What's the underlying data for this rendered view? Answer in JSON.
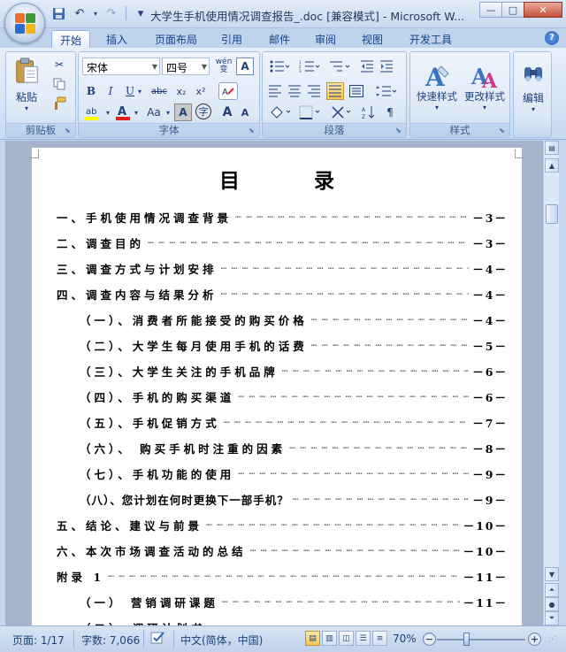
{
  "window": {
    "title": "大学生手机使用情况调查报告_.doc [兼容模式] - Microsoft W...",
    "min_label": "—",
    "max_label": "□",
    "close_label": "✕"
  },
  "quick_access": {
    "save_icon": "floppy-disk-icon",
    "undo_label": "↶",
    "redo_label": "↷",
    "customize_label": "▾"
  },
  "tabs": [
    {
      "label": "开始",
      "active": true
    },
    {
      "label": "插入"
    },
    {
      "label": "页面布局"
    },
    {
      "label": "引用"
    },
    {
      "label": "邮件"
    },
    {
      "label": "审阅"
    },
    {
      "label": "视图"
    },
    {
      "label": "开发工具"
    }
  ],
  "ribbon": {
    "clipboard": {
      "label": "剪贴板",
      "paste_label": "粘贴"
    },
    "font": {
      "label": "字体",
      "font_name": "宋体",
      "font_size": "四号",
      "wen_label": "wén\n变",
      "bold": "B",
      "italic": "I",
      "underline": "U",
      "strike": "abc",
      "sub": "x₂",
      "sup": "x²",
      "case": "Aa",
      "grow": "A",
      "shrink": "A",
      "border_a": "A",
      "circle": "字"
    },
    "paragraph": {
      "label": "段落"
    },
    "styles": {
      "label": "样式",
      "quick_styles": "快速样式",
      "change_styles": "更改样式"
    },
    "editing": {
      "label": "编辑"
    }
  },
  "document": {
    "title": "目 录",
    "toc": [
      {
        "label": "一、手机使用情况调查背景",
        "page": "－3－",
        "indent": false
      },
      {
        "label": "二、调查目的",
        "page": "－3－",
        "indent": false
      },
      {
        "label": "三、调查方式与计划安排",
        "page": "－4－",
        "indent": false
      },
      {
        "label": "四、调查内容与结果分析",
        "page": "－4－",
        "indent": false
      },
      {
        "label": "（一）、消费者所能接受的购买价格",
        "page": "－4－",
        "indent": true
      },
      {
        "label": "（二）、大学生每月使用手机的话费",
        "page": "－5－",
        "indent": true
      },
      {
        "label": "（三）、大学生关注的手机品牌",
        "page": "－6－",
        "indent": true
      },
      {
        "label": "（四）、手机的购买渠道",
        "page": "－6－",
        "indent": true
      },
      {
        "label": "（五）、手机促销方式",
        "page": "－7－",
        "indent": true
      },
      {
        "label": "（六）、 购买手机时注重的因素",
        "page": "－8－",
        "indent": true
      },
      {
        "label": "（七）、手机功能的使用",
        "page": "－9－",
        "indent": true
      },
      {
        "label": "（八）、您计划在何时更换下一部手机？",
        "page": "－9－",
        "indent": true,
        "tight": true
      },
      {
        "label": "五、结论、建议与前景",
        "page": "－10－",
        "indent": false
      },
      {
        "label": "六、本次市场调查活动的总结",
        "page": "－10－",
        "indent": false
      },
      {
        "label": "附录 1",
        "page": "－11－",
        "indent": false
      },
      {
        "label": "（一） 营销调研课题",
        "page": "－11－",
        "indent": true
      }
    ],
    "partial_row": "（二）、调研计划书"
  },
  "status": {
    "page": "页面: 1/17",
    "words": "字数: 7,066",
    "language": "中文(简体，中国)",
    "zoom": "70%",
    "zoom_value": 0.7
  }
}
